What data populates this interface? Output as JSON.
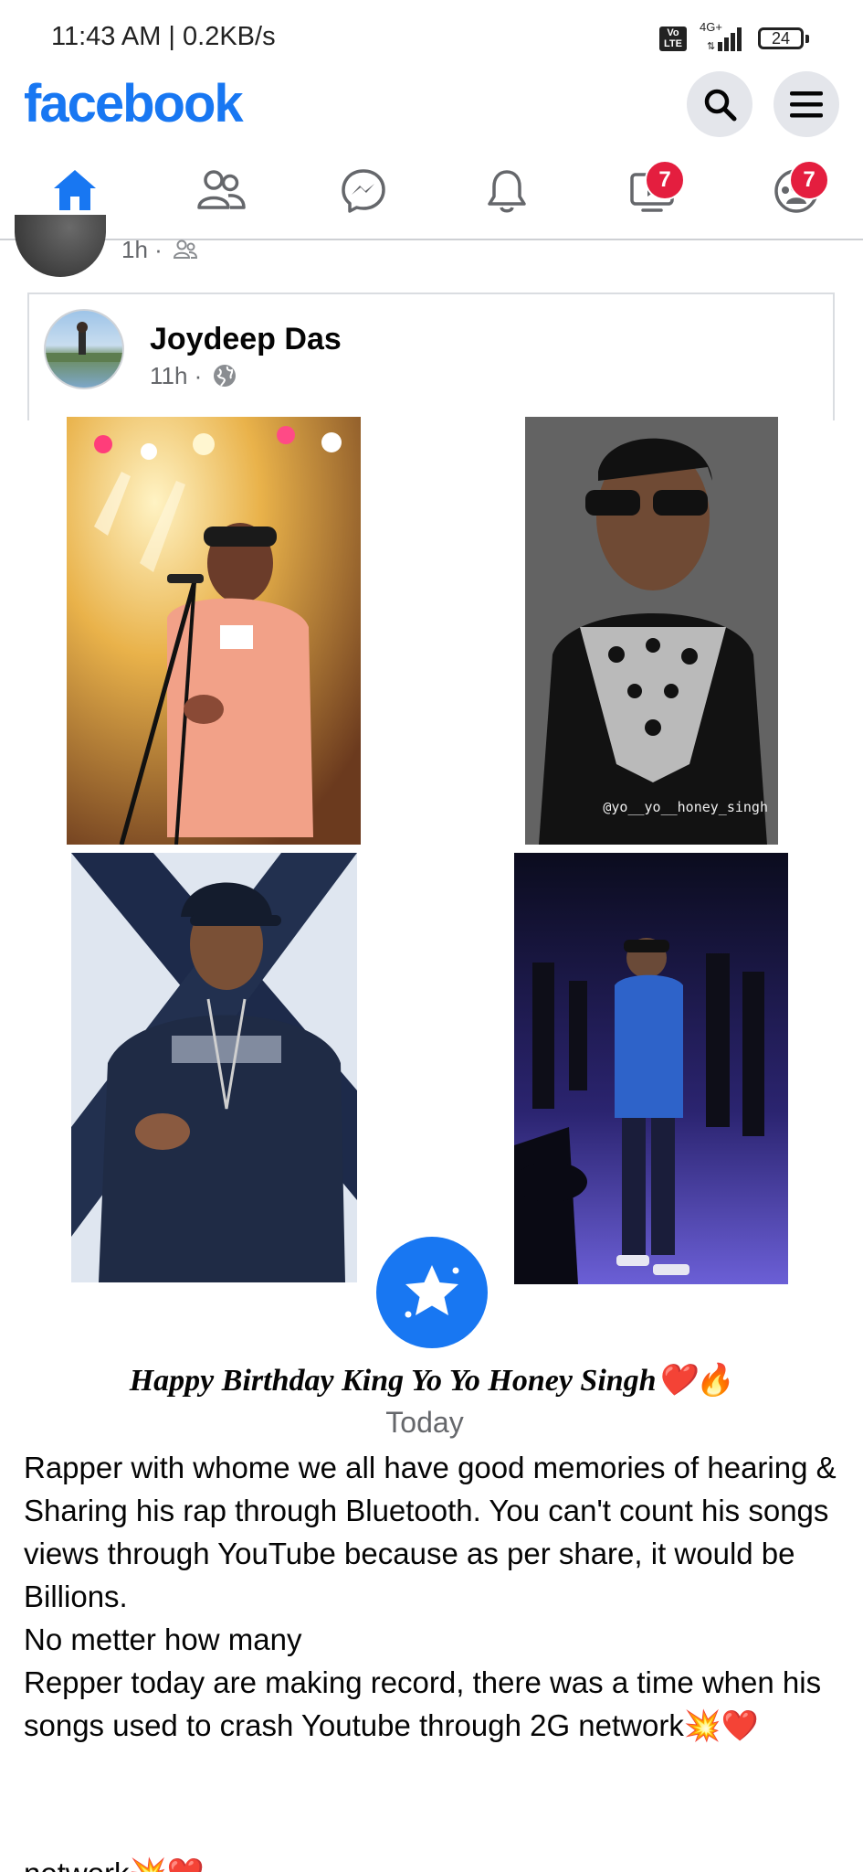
{
  "status_bar": {
    "time_speed": "11:43 AM | 0.2KB/s",
    "volte": "Vo LTE",
    "network": "4G+",
    "battery": "24"
  },
  "header": {
    "brand": "facebook",
    "search_icon": "search-icon",
    "menu_icon": "menu-icon",
    "brand_color": "#1877f2"
  },
  "nav": {
    "tabs": [
      {
        "icon": "home-icon",
        "active": true
      },
      {
        "icon": "friends-icon"
      },
      {
        "icon": "messenger-icon"
      },
      {
        "icon": "bell-icon"
      },
      {
        "icon": "watch-icon",
        "badge": "7"
      },
      {
        "icon": "groups-icon",
        "badge": "7"
      }
    ],
    "badge_color": "#e41e3f"
  },
  "previous_post": {
    "time": "1h ·"
  },
  "post": {
    "author": "Joydeep Das",
    "time": "11h ·",
    "photo_watermark": "@yo__yo__honey_singh",
    "caption_title": "Happy Birthday King Yo Yo Honey Singh❤️🔥",
    "caption_date": "Today",
    "body": "Rapper with whome we all have good memories of hearing & Sharing his rap through Bluetooth. You can't count his songs views through YouTube because as per share, it would be Billions.\nNo metter how many\nRepper today are making record, there was a time when his songs used to crash Youtube through 2G network💥❤️",
    "ghost_line": "network💥❤️"
  }
}
